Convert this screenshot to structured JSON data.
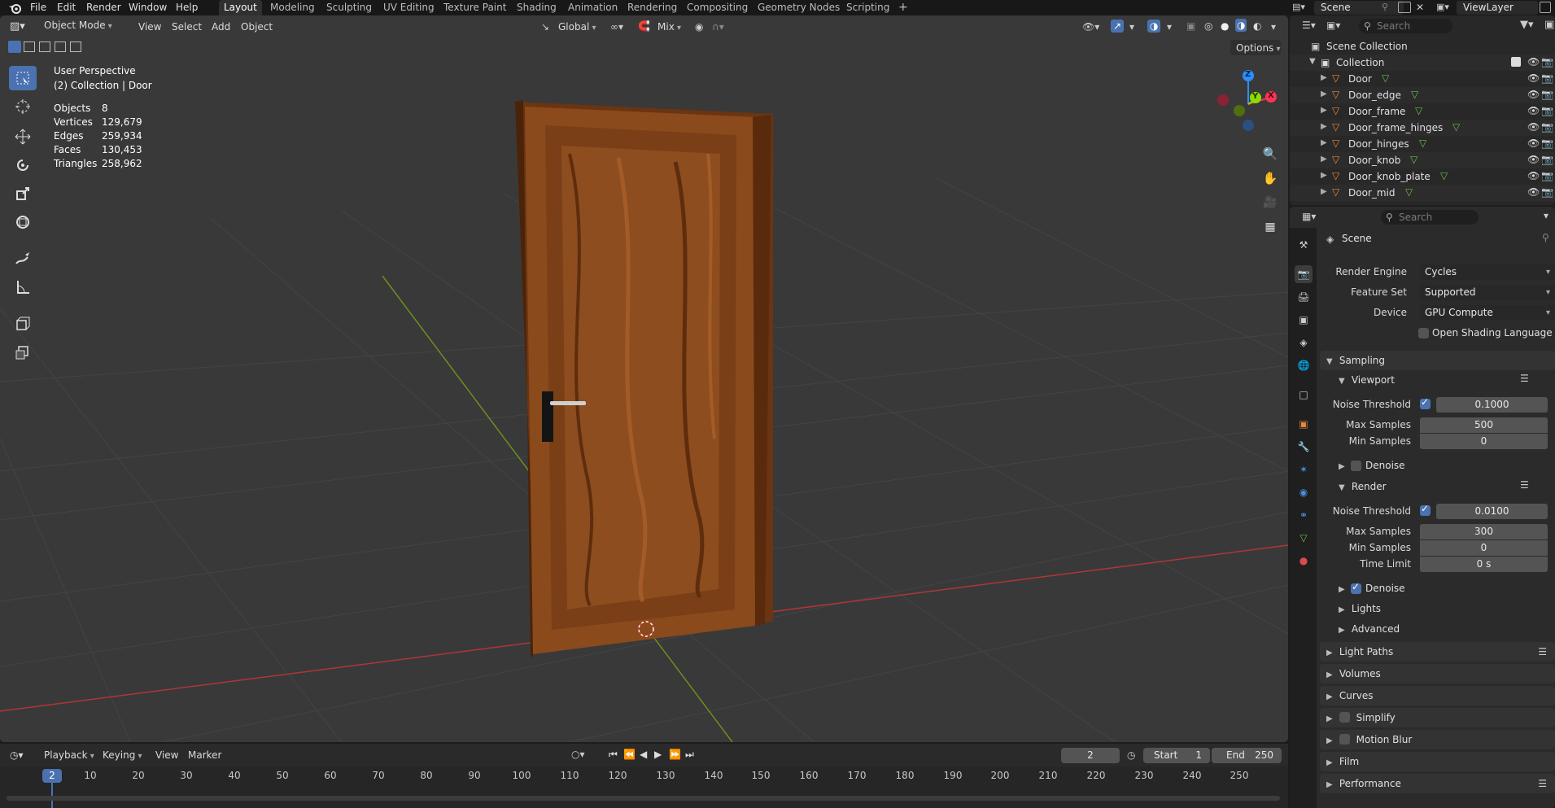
{
  "top_menu": [
    "File",
    "Edit",
    "Render",
    "Window",
    "Help"
  ],
  "workspace_tabs": [
    "Layout",
    "Modeling",
    "Sculpting",
    "UV Editing",
    "Texture Paint",
    "Shading",
    "Animation",
    "Rendering",
    "Compositing",
    "Geometry Nodes",
    "Scripting"
  ],
  "active_tab": "Layout",
  "scene": {
    "label": "Scene",
    "view_layer": "ViewLayer"
  },
  "viewport": {
    "mode": "Object Mode",
    "menus": [
      "View",
      "Select",
      "Add",
      "Object"
    ],
    "transform_orientation": "Global",
    "snap_mode": "Mix",
    "options_label": "Options",
    "perspective_label": "User Perspective",
    "context_label": "(2) Collection | Door",
    "stats": [
      {
        "label": "Objects",
        "value": "8"
      },
      {
        "label": "Vertices",
        "value": "129,679"
      },
      {
        "label": "Edges",
        "value": "259,934"
      },
      {
        "label": "Faces",
        "value": "130,453"
      },
      {
        "label": "Triangles",
        "value": "258,962"
      }
    ],
    "gizmo_axes": [
      "Z",
      "Y",
      "X"
    ]
  },
  "timeline": {
    "menus": [
      "Playback",
      "Keying",
      "View",
      "Marker"
    ],
    "current_frame": "2",
    "start_label": "Start",
    "start": "1",
    "end_label": "End",
    "end": "250",
    "ruler": [
      "10",
      "20",
      "30",
      "40",
      "50",
      "60",
      "70",
      "80",
      "90",
      "100",
      "110",
      "120",
      "130",
      "140",
      "150",
      "160",
      "170",
      "180",
      "190",
      "200",
      "210",
      "220",
      "230",
      "240",
      "250"
    ],
    "playhead": "2"
  },
  "outliner": {
    "search_placeholder": "Search",
    "root": "Scene Collection",
    "collection": "Collection",
    "items": [
      "Door",
      "Door_edge",
      "Door_frame",
      "Door_frame_hinges",
      "Door_hinges",
      "Door_knob",
      "Door_knob_plate",
      "Door_mid"
    ]
  },
  "properties": {
    "search_placeholder": "Search",
    "context": "Scene",
    "render_engine_label": "Render Engine",
    "render_engine": "Cycles",
    "feature_set_label": "Feature Set",
    "feature_set": "Supported",
    "device_label": "Device",
    "device": "GPU Compute",
    "osl_label": "Open Shading Language",
    "sampling_label": "Sampling",
    "viewport_label": "Viewport",
    "noise_threshold_label": "Noise Threshold",
    "viewport_noise_threshold": "0.1000",
    "max_samples_label": "Max Samples",
    "viewport_max_samples": "500",
    "min_samples_label": "Min Samples",
    "viewport_min_samples": "0",
    "denoise_label": "Denoise",
    "render_label": "Render",
    "render_noise_threshold": "0.0100",
    "render_max_samples": "300",
    "render_min_samples": "0",
    "time_limit_label": "Time Limit",
    "time_limit": "0 s",
    "lights_label": "Lights",
    "advanced_label": "Advanced",
    "panels": [
      "Light Paths",
      "Volumes",
      "Curves",
      "Simplify",
      "Motion Blur",
      "Film",
      "Performance"
    ]
  },
  "colors": {
    "accent": "#4a72b0",
    "axis_x": "#ff3352",
    "axis_y": "#8bdc00",
    "axis_z": "#2890ff",
    "door_wood": "#8a4a1c",
    "mesh_icon": "#e8873a"
  }
}
